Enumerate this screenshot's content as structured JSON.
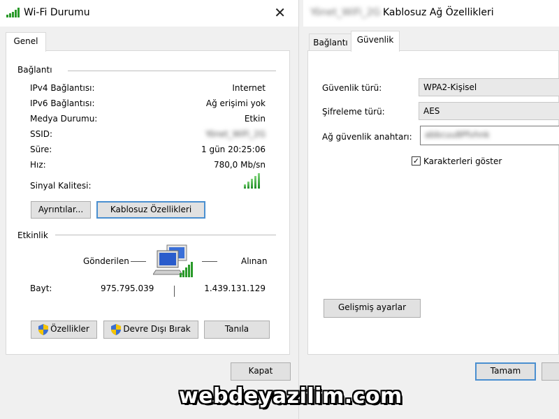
{
  "left_dialog": {
    "title": "Wi-Fi Durumu",
    "tab_general": "Genel",
    "connection": {
      "heading": "Bağlantı",
      "rows": [
        {
          "label": "IPv4 Bağlantısı:",
          "value": "Internet"
        },
        {
          "label": "IPv6 Bağlantısı:",
          "value": "Ağ erişimi yok"
        },
        {
          "label": "Medya Durumu:",
          "value": "Etkin"
        },
        {
          "label": "SSID:",
          "value": "Yönet_WiFi_2G"
        },
        {
          "label": "Süre:",
          "value": "1 gün 20:25:06"
        },
        {
          "label": "Hız:",
          "value": "780,0 Mb/sn"
        }
      ],
      "signal_label": "Sinyal Kalitesi:",
      "signal_bars": 5,
      "details_button": "Ayrıntılar...",
      "wireless_props_button": "Kablosuz Özellikleri"
    },
    "activity": {
      "heading": "Etkinlik",
      "sent_label": "Gönderilen",
      "received_label": "Alınan",
      "bytes_label": "Bayt:",
      "bytes_sent": "975.795.039",
      "bytes_received": "1.439.131.129"
    },
    "properties_button": "Özellikler",
    "disable_button": "Devre Dışı Bırak",
    "diagnose_button": "Tanıla",
    "close_button": "Kapat"
  },
  "right_dialog": {
    "title_blurred": "Yönet_WiFi_2G",
    "title": "Kablosuz Ağ Özellikleri",
    "tab_connection": "Bağlantı",
    "tab_security": "Güvenlik",
    "security_type_label": "Güvenlik türü:",
    "security_type_value": "WPA2-Kişisel",
    "encryption_type_label": "Şifreleme türü:",
    "encryption_type_value": "AES",
    "network_key_label": "Ağ güvenlik anahtarı:",
    "network_key_value": "abbcuu8Pfvhnk",
    "show_characters_label": "Karakterleri göster",
    "show_characters_checked": true,
    "advanced_button": "Gelişmiş ayarlar",
    "ok_button": "Tamam"
  },
  "watermark": "webdeyazilim.com",
  "colors": {
    "signal_green": "#1e8b24",
    "focus_blue": "#4a8fd0",
    "button_bg": "#e1e1e1",
    "window_bg": "#f0f0f0"
  }
}
